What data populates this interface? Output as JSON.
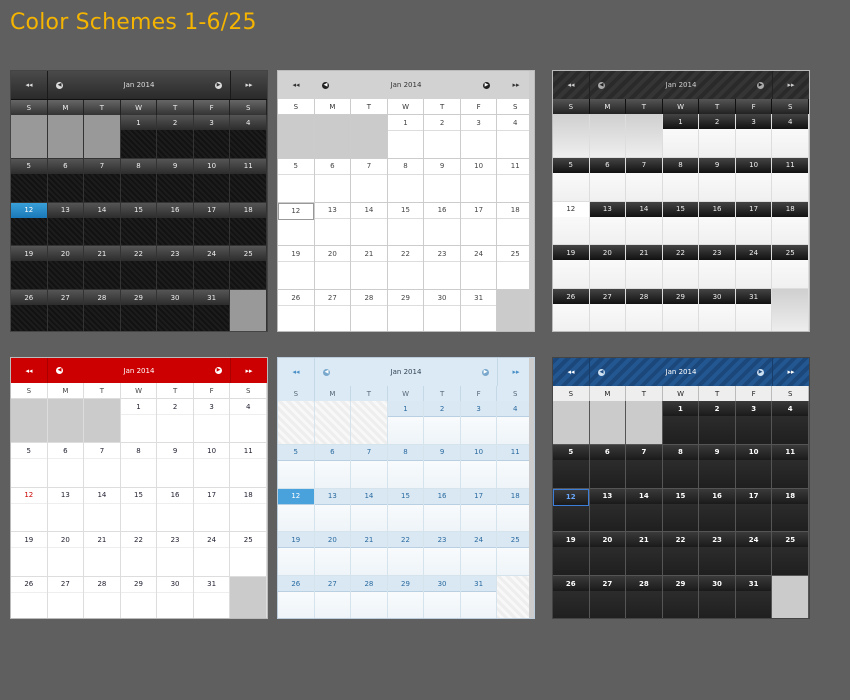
{
  "page": {
    "title": "Color Schemes 1-6/25"
  },
  "calendar": {
    "month_label": "Jan  2014",
    "prev_year_glyph": "◂◂",
    "next_year_glyph": "▸▸",
    "prev_month_glyph": "◀",
    "next_month_glyph": "▶",
    "weekdays": [
      "S",
      "M",
      "T",
      "W",
      "T",
      "F",
      "S"
    ],
    "leading_blank_days": 3,
    "days_in_month": 31,
    "selected_day": 12
  },
  "schemes": [
    {
      "id": "s1",
      "name": "dark"
    },
    {
      "id": "s2",
      "name": "white-gray"
    },
    {
      "id": "s3",
      "name": "black-headers"
    },
    {
      "id": "s4",
      "name": "red"
    },
    {
      "id": "s5",
      "name": "light-blue"
    },
    {
      "id": "s6",
      "name": "navy"
    }
  ],
  "colors": {
    "background": "#5f5f5f",
    "title": "#f5b400",
    "red": "#cc0000",
    "blue": "#4aa2dc",
    "navy": "#1f4f86"
  }
}
